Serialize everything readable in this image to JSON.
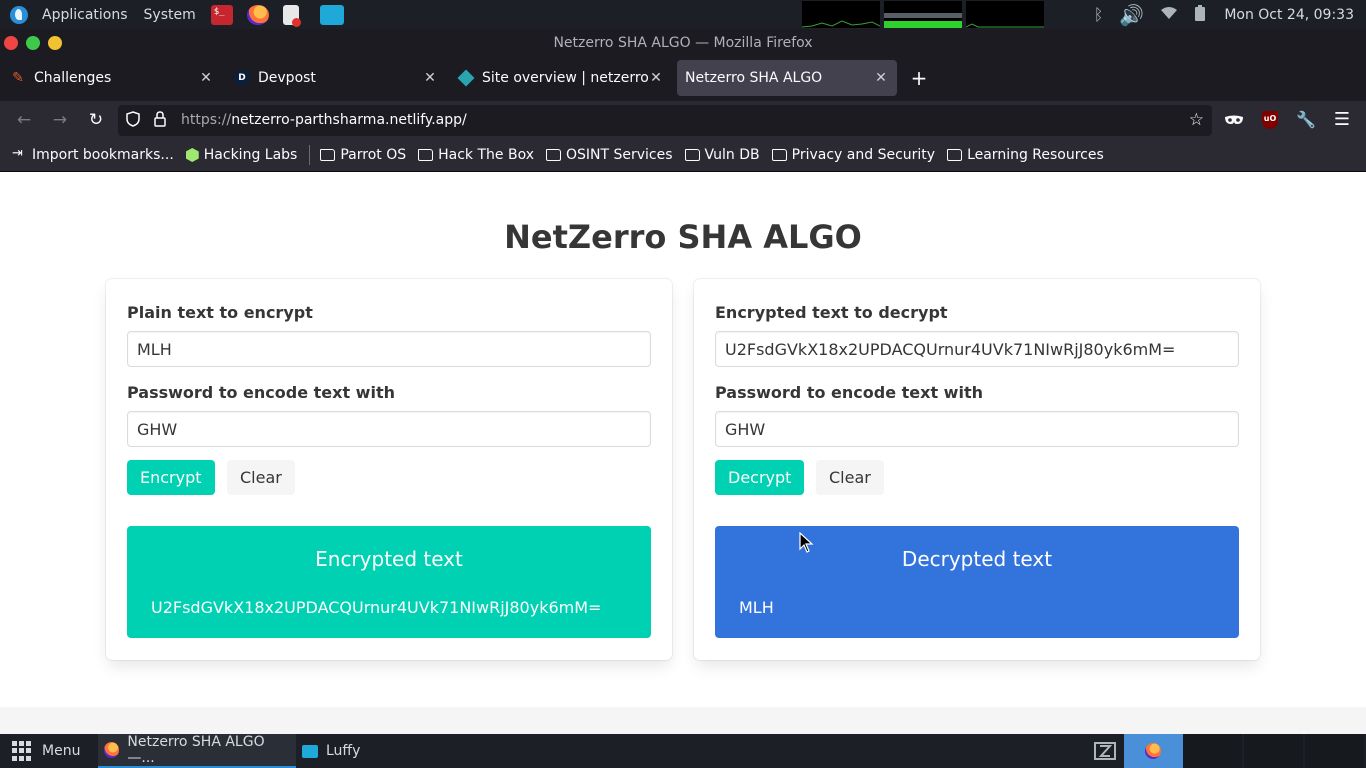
{
  "system_panel": {
    "applications_label": "Applications",
    "system_label": "System",
    "clock": "Mon Oct 24, 09:33"
  },
  "window": {
    "title": "Netzerro SHA ALGO — Mozilla Firefox"
  },
  "tabs": [
    {
      "label": "Challenges",
      "icon": "challenges-favicon"
    },
    {
      "label": "Devpost",
      "icon": "devpost-favicon"
    },
    {
      "label": "Site overview | netzerro-p",
      "icon": "netlify-favicon"
    },
    {
      "label": "Netzerro SHA ALGO",
      "icon": "none",
      "active": true
    }
  ],
  "urlbar": {
    "scheme": "https://",
    "host": "netzerro-parthsharma.netlify.app/"
  },
  "bookmarks": [
    {
      "label": "Import bookmarks...",
      "icon": "import-icon"
    },
    {
      "label": "Hacking Labs",
      "icon": "hacking-labs-icon"
    },
    {
      "label": "Parrot OS",
      "icon": "folder-icon"
    },
    {
      "label": "Hack The Box",
      "icon": "folder-icon"
    },
    {
      "label": "OSINT Services",
      "icon": "folder-icon"
    },
    {
      "label": "Vuln DB",
      "icon": "folder-icon"
    },
    {
      "label": "Privacy and Security",
      "icon": "folder-icon"
    },
    {
      "label": "Learning Resources",
      "icon": "folder-icon"
    }
  ],
  "page": {
    "title": "NetZerro SHA ALGO",
    "encrypt": {
      "plain_label": "Plain text to encrypt",
      "plain_value": "MLH",
      "password_label": "Password to encode text with",
      "password_value": "GHW",
      "action_label": "Encrypt",
      "clear_label": "Clear",
      "result_title": "Encrypted text",
      "result_value": "U2FsdGVkX18x2UPDACQUrnur4UVk71NIwRjJ80yk6mM="
    },
    "decrypt": {
      "cipher_label": "Encrypted text to decrypt",
      "cipher_value": "U2FsdGVkX18x2UPDACQUrnur4UVk71NIwRjJ80yk6mM=",
      "password_label": "Password to encode text with",
      "password_value": "GHW",
      "action_label": "Decrypt",
      "clear_label": "Clear",
      "result_title": "Decrypted text",
      "result_value": "MLH"
    }
  },
  "taskbar": {
    "menu_label": "Menu",
    "tasks": [
      {
        "label": "Netzerro SHA ALGO —...",
        "icon": "firefox-icon",
        "active": true
      },
      {
        "label": "Luffy",
        "icon": "folder-icon"
      }
    ]
  },
  "colors": {
    "primary": "#00d1b2",
    "info": "#3273dc",
    "title_text": "#363636",
    "browser_dark": "#1c1b22",
    "browser_toolbar": "#2b2a33"
  }
}
